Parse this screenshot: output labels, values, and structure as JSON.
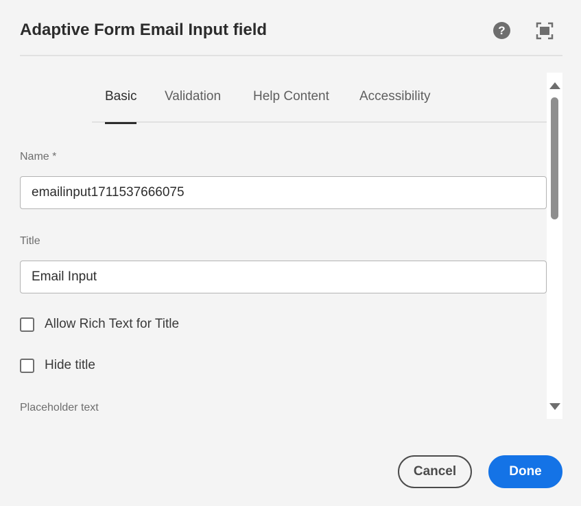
{
  "dialog": {
    "title": "Adaptive Form Email Input field",
    "help_icon_glyph": "?",
    "help_icon": "help-circle-icon",
    "fullscreen_icon": "fullscreen-icon"
  },
  "tabs": [
    {
      "label": "Basic",
      "active": true
    },
    {
      "label": "Validation",
      "active": false
    },
    {
      "label": "Help Content",
      "active": false
    },
    {
      "label": "Accessibility",
      "active": false
    }
  ],
  "fields": {
    "name": {
      "label": "Name *",
      "value": "emailinput1711537666075"
    },
    "title": {
      "label": "Title",
      "value": "Email Input"
    },
    "allow_rich_text": {
      "label": "Allow Rich Text for Title",
      "checked": false
    },
    "hide_title": {
      "label": "Hide title",
      "checked": false
    },
    "placeholder": {
      "label": "Placeholder text"
    }
  },
  "footer": {
    "cancel_label": "Cancel",
    "done_label": "Done"
  },
  "colors": {
    "accent": "#1473e6",
    "background": "#f4f4f4"
  }
}
